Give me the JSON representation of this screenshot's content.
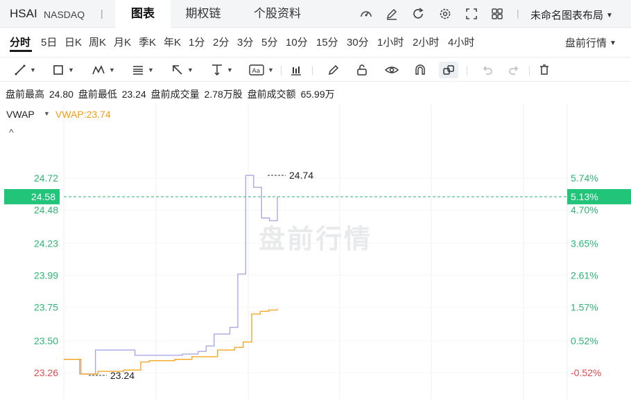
{
  "header": {
    "ticker": "HSAI",
    "exchange": "NASDAQ",
    "divider": "|",
    "tabs": [
      "图表",
      "期权链",
      "个股资料"
    ],
    "active_tab": "图表",
    "layout_label": "未命名图表布局",
    "icons": [
      "speedometer-icon",
      "edit-icon",
      "refresh-icon",
      "gear-icon",
      "fullscreen-icon",
      "grid-icon"
    ]
  },
  "periods": {
    "items": [
      "分时",
      "5日",
      "日K",
      "周K",
      "月K",
      "季K",
      "年K",
      "1分",
      "2分",
      "3分",
      "5分",
      "10分",
      "15分",
      "30分",
      "1小时",
      "2小时",
      "4小时"
    ],
    "active": "分时",
    "session_select": "盘前行情"
  },
  "toolbar": {
    "tools": [
      "line-tool-icon",
      "rectangle-tool-icon",
      "pattern-tool-icon",
      "fib-tool-icon",
      "arrow-tool-icon",
      "measure-tool-icon",
      "text-tool-icon",
      "indicator-icon",
      "pen-icon",
      "lock-icon",
      "eye-icon",
      "magnet-icon",
      "link-icon",
      "undo-icon",
      "redo-icon",
      "delete-icon"
    ]
  },
  "stats": {
    "high_label": "盘前最高",
    "high_value": "24.80",
    "low_label": "盘前最低",
    "low_value": "23.24",
    "volume_label": "盘前成交量",
    "volume_value": "2.78万股",
    "turnover_label": "盘前成交额",
    "turnover_value": "65.99万"
  },
  "indicator": {
    "name": "VWAP",
    "value_text": "VWAP:23.74",
    "collapse_symbol": "^"
  },
  "chart_data": {
    "type": "line",
    "watermark": "盘前行情",
    "current_price": "24.58",
    "current_change": "5.13%",
    "y_ticks": [
      "24.72",
      "24.48",
      "24.23",
      "23.99",
      "23.75",
      "23.50",
      "23.26"
    ],
    "y_tick_values": [
      24.72,
      24.48,
      24.23,
      23.99,
      23.75,
      23.5,
      23.26
    ],
    "pct_ticks": [
      "5.74%",
      "4.70%",
      "3.65%",
      "2.61%",
      "1.57%",
      "0.52%",
      "-0.52%"
    ],
    "ylim": [
      23.26,
      24.72
    ],
    "high_marker": "24.74",
    "low_marker": "23.24",
    "series": [
      {
        "name": "price",
        "color": "#a9a8e6",
        "values": [
          23.36,
          23.36,
          23.25,
          23.25,
          23.43,
          23.43,
          23.43,
          23.43,
          23.43,
          23.39,
          23.39,
          23.39,
          23.39,
          23.39,
          23.39,
          23.4,
          23.4,
          23.42,
          23.46,
          23.55,
          23.55,
          23.6,
          24.0,
          24.74,
          24.65,
          24.42,
          24.4,
          24.58
        ]
      },
      {
        "name": "VWAP",
        "color": "#f5a623",
        "values": [
          23.36,
          23.36,
          23.25,
          23.25,
          23.27,
          23.27,
          23.27,
          23.28,
          23.28,
          23.34,
          23.35,
          23.35,
          23.35,
          23.36,
          23.36,
          23.38,
          23.38,
          23.38,
          23.43,
          23.43,
          23.45,
          23.49,
          23.7,
          23.72,
          23.73,
          23.74
        ]
      }
    ]
  }
}
